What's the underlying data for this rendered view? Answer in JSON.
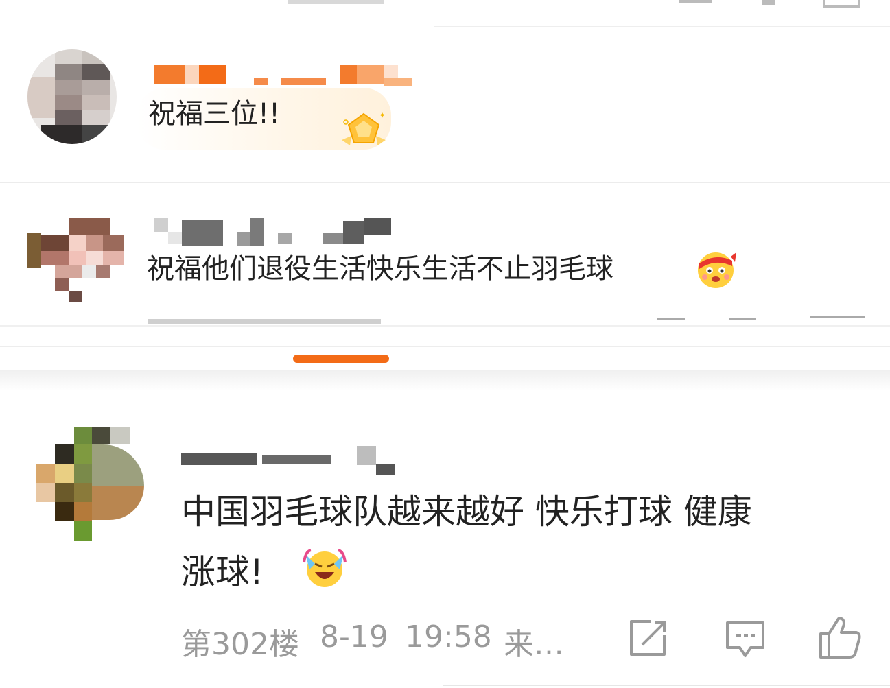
{
  "comments": [
    {
      "text": "祝福三位!!",
      "badge_icon": "gold-medal-badge-icon"
    },
    {
      "text": "祝福他们退役生活快乐生活不止羽毛球",
      "emoji_icon": "cheering-face-emoji-icon"
    },
    {
      "text_line1": "中国羽毛球队越来越好 快乐打球 健康",
      "text_line2": "涨球!",
      "emoji_icon": "laughing-tears-emoji-icon",
      "footer": {
        "floor": "第302楼",
        "date": "8-19",
        "time": "19:58",
        "source": "来…"
      },
      "actions": {
        "share_icon": "share-icon",
        "comment_icon": "comment-icon",
        "like_icon": "thumbs-up-icon"
      }
    }
  ],
  "colors": {
    "accent": "#f36b17",
    "text": "#222222",
    "meta": "#9a9a9a",
    "divider": "#ececec"
  }
}
